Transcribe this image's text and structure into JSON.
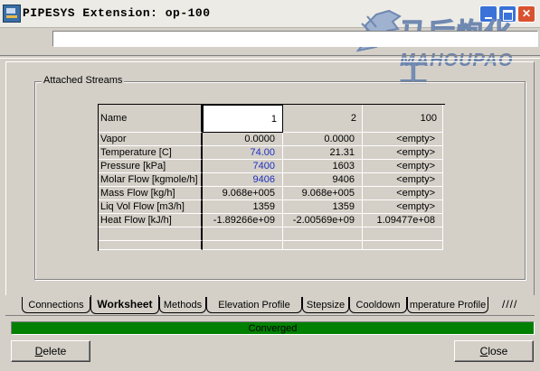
{
  "window": {
    "title": "PIPESYS   Extension: op-100"
  },
  "watermark": {
    "cn": "马后炮化工",
    "en": "MAHOUPAO"
  },
  "groupbox": {
    "label": "Attached Streams"
  },
  "grid": {
    "header": {
      "label": "Name",
      "cols": [
        "1",
        "2",
        "100"
      ]
    },
    "rows": [
      {
        "label": "Vapor",
        "values": [
          "0.0000",
          "0.0000",
          "<empty>"
        ]
      },
      {
        "label": "Temperature [C]",
        "values": [
          "74.00",
          "21.31",
          "<empty>"
        ]
      },
      {
        "label": "Pressure [kPa]",
        "values": [
          "7400",
          "1603",
          "<empty>"
        ]
      },
      {
        "label": "Molar Flow [kgmole/h]",
        "values": [
          "9406",
          "9406",
          "<empty>"
        ]
      },
      {
        "label": "Mass Flow [kg/h]",
        "values": [
          "9.068e+005",
          "9.068e+005",
          "<empty>"
        ]
      },
      {
        "label": "Liq Vol Flow [m3/h]",
        "values": [
          "1359",
          "1359",
          "<empty>"
        ]
      },
      {
        "label": "Heat Flow [kJ/h]",
        "values": [
          "-1.89266e+09",
          "-2.00569e+09",
          "1.09477e+08"
        ]
      }
    ]
  },
  "tabs": [
    "Connections",
    "Worksheet",
    "Methods",
    "Elevation Profile",
    "Stepsize",
    "Cooldown",
    "mperature Profile"
  ],
  "active_tab": "Worksheet",
  "status": {
    "text": "Converged",
    "color": "#008000"
  },
  "buttons": {
    "delete_first": "D",
    "delete_rest": "elete",
    "close_first": "C",
    "close_rest": "lose"
  }
}
